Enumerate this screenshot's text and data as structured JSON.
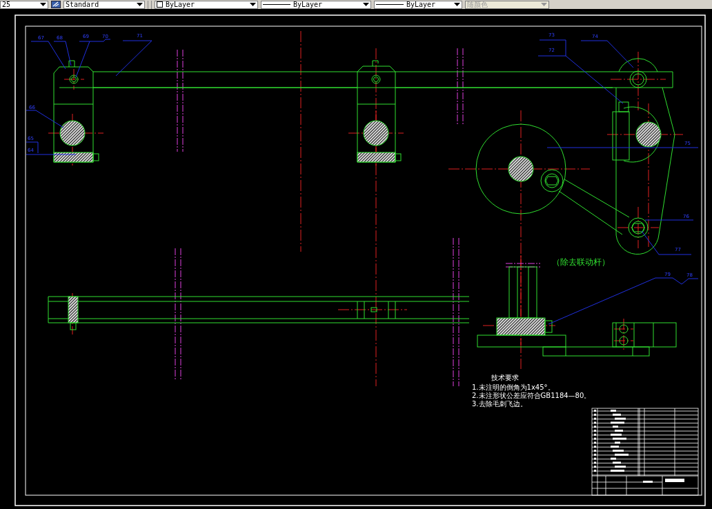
{
  "toolbar": [
    {
      "kind": "combo",
      "value": "25",
      "disabled": false
    },
    {
      "kind": "style-combo",
      "value": "Standard",
      "disabled": false
    },
    {
      "kind": "color-combo",
      "value": "ByLayer",
      "disabled": false
    },
    {
      "kind": "linetype-combo",
      "value": "ByLayer",
      "disabled": false
    },
    {
      "kind": "linetype-combo",
      "value": "ByLayer",
      "disabled": false
    },
    {
      "kind": "combo",
      "value": "随颜色",
      "disabled": true
    }
  ],
  "drawing": {
    "part_numbers": [
      "67",
      "68",
      "69",
      "70",
      "71",
      "66",
      "65",
      "64",
      "73",
      "72",
      "74",
      "75",
      "76",
      "77",
      "79",
      "78"
    ],
    "note": "（除去联动杆）",
    "technical_requirements": {
      "title": "技术要求",
      "lines": [
        "1.未注明的倒角为1x45°。",
        "2.未注形状公差应符合GB1184—80。",
        "3.去除毛刺飞边。"
      ]
    }
  }
}
